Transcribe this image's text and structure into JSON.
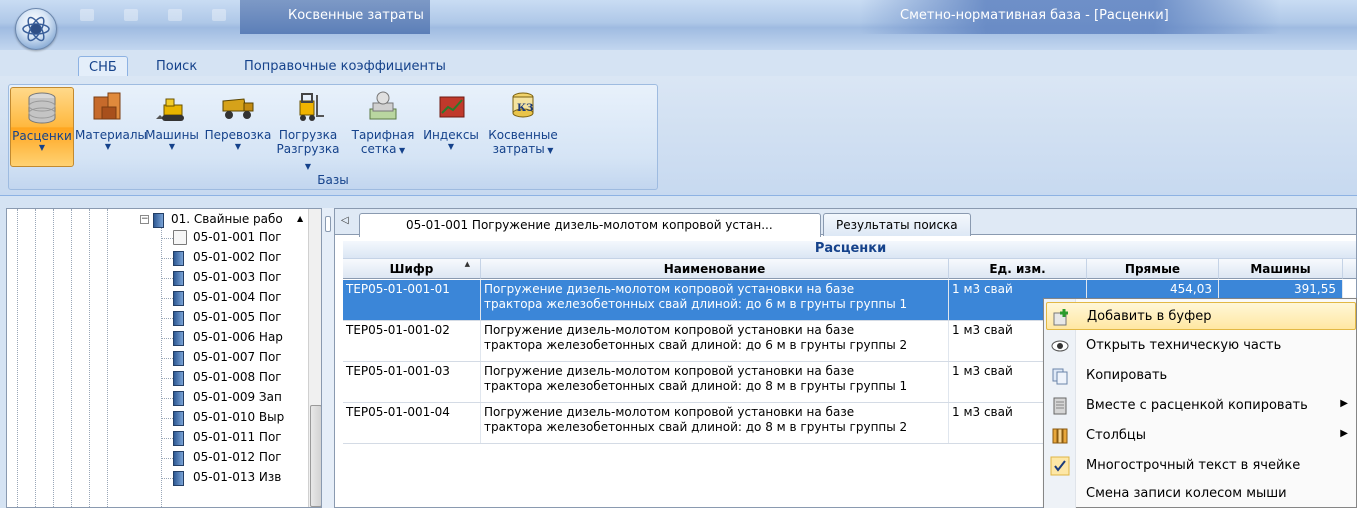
{
  "window": {
    "context_tab_title": "Косвенные затраты",
    "title": "Сметно-нормативная база - [Расценки]"
  },
  "ribbon": {
    "tabs": [
      {
        "label": "СНБ",
        "active": true
      },
      {
        "label": "Поиск",
        "active": false
      },
      {
        "label": "Поправочные коэффициенты",
        "active": false
      }
    ],
    "group_label": "Базы",
    "buttons": [
      {
        "line1": "Расценки",
        "line2": "",
        "icon": "database-icon",
        "active": true
      },
      {
        "line1": "Материалы",
        "line2": "",
        "icon": "bricks-icon",
        "active": false
      },
      {
        "line1": "Машины",
        "line2": "",
        "icon": "excavator-icon",
        "active": false
      },
      {
        "line1": "Перевозка",
        "line2": "",
        "icon": "dump-truck-icon",
        "active": false
      },
      {
        "line1": "Погрузка",
        "line2": "Разгрузка",
        "icon": "forklift-icon",
        "active": false
      },
      {
        "line1": "Тарифная",
        "line2": "сетка",
        "icon": "money-icon",
        "active": false
      },
      {
        "line1": "Индексы",
        "line2": "",
        "icon": "chart-icon",
        "active": false
      },
      {
        "line1": "Косвенные",
        "line2": "затраты",
        "icon": "coins-icon",
        "active": false
      }
    ]
  },
  "tree": {
    "parent": "01. Свайные рабо",
    "items": [
      "05-01-001 Пог",
      "05-01-002 Пог",
      "05-01-003 Пог",
      "05-01-004 Пог",
      "05-01-005 Пог",
      "05-01-006 Нар",
      "05-01-007 Пог",
      "05-01-008 Пог",
      "05-01-009 Зап",
      "05-01-010 Выр",
      "05-01-011 Пог",
      "05-01-012 Пог",
      "05-01-013 Изв"
    ]
  },
  "doc_tabs": [
    {
      "label": "05-01-001 Погружение дизель-молотом копровой устан...",
      "active": true
    },
    {
      "label": "Результаты поиска",
      "active": false
    }
  ],
  "grid": {
    "band_title": "Расценки",
    "columns": [
      "Шифр",
      "Наименование",
      "Ед. изм.",
      "Прямые",
      "Машины"
    ],
    "rows": [
      {
        "code": "ТЕР05-01-001-01",
        "name1": "Погружение дизель-молотом копровой установки на базе",
        "name2": "трактора железобетонных свай длиной: до 6 м в грунты группы 1",
        "unit": "1 м3 свай",
        "direct": "454,03",
        "machines": "391,55",
        "selected": true
      },
      {
        "code": "ТЕР05-01-001-02",
        "name1": "Погружение дизель-молотом копровой установки на базе",
        "name2": "трактора железобетонных свай длиной: до 6 м в грунты группы 2",
        "unit": "1 м3 свай",
        "direct": "",
        "machines": "",
        "selected": false
      },
      {
        "code": "ТЕР05-01-001-03",
        "name1": "Погружение дизель-молотом копровой установки на базе",
        "name2": "трактора железобетонных свай длиной: до 8 м в грунты группы 1",
        "unit": "1 м3 свай",
        "direct": "",
        "machines": "",
        "selected": false
      },
      {
        "code": "ТЕР05-01-001-04",
        "name1": "Погружение дизель-молотом копровой установки на базе",
        "name2": "трактора железобетонных свай длиной: до 8 м в грунты группы 2",
        "unit": "1 м3 свай",
        "direct": "",
        "machines": "",
        "selected": false
      }
    ]
  },
  "context_menu": {
    "items": [
      {
        "label": "Добавить в буфер",
        "icon": "add-to-buffer-icon",
        "submenu": false,
        "highlighted": true
      },
      {
        "label": "Открыть техническую часть",
        "icon": "eye-icon",
        "submenu": false,
        "highlighted": false
      },
      {
        "label": "Копировать",
        "icon": "copy-icon",
        "submenu": false,
        "highlighted": false
      },
      {
        "label": "Вместе с расценкой копировать",
        "icon": "copy-with-icon",
        "submenu": true,
        "highlighted": false
      },
      {
        "label": "Столбцы",
        "icon": "columns-icon",
        "submenu": true,
        "highlighted": false
      },
      {
        "label": "Многострочный текст в ячейке",
        "icon": "check-icon",
        "submenu": false,
        "highlighted": false
      },
      {
        "label": "Смена записи колесом мыши",
        "icon": "",
        "submenu": false,
        "highlighted": false
      }
    ]
  }
}
